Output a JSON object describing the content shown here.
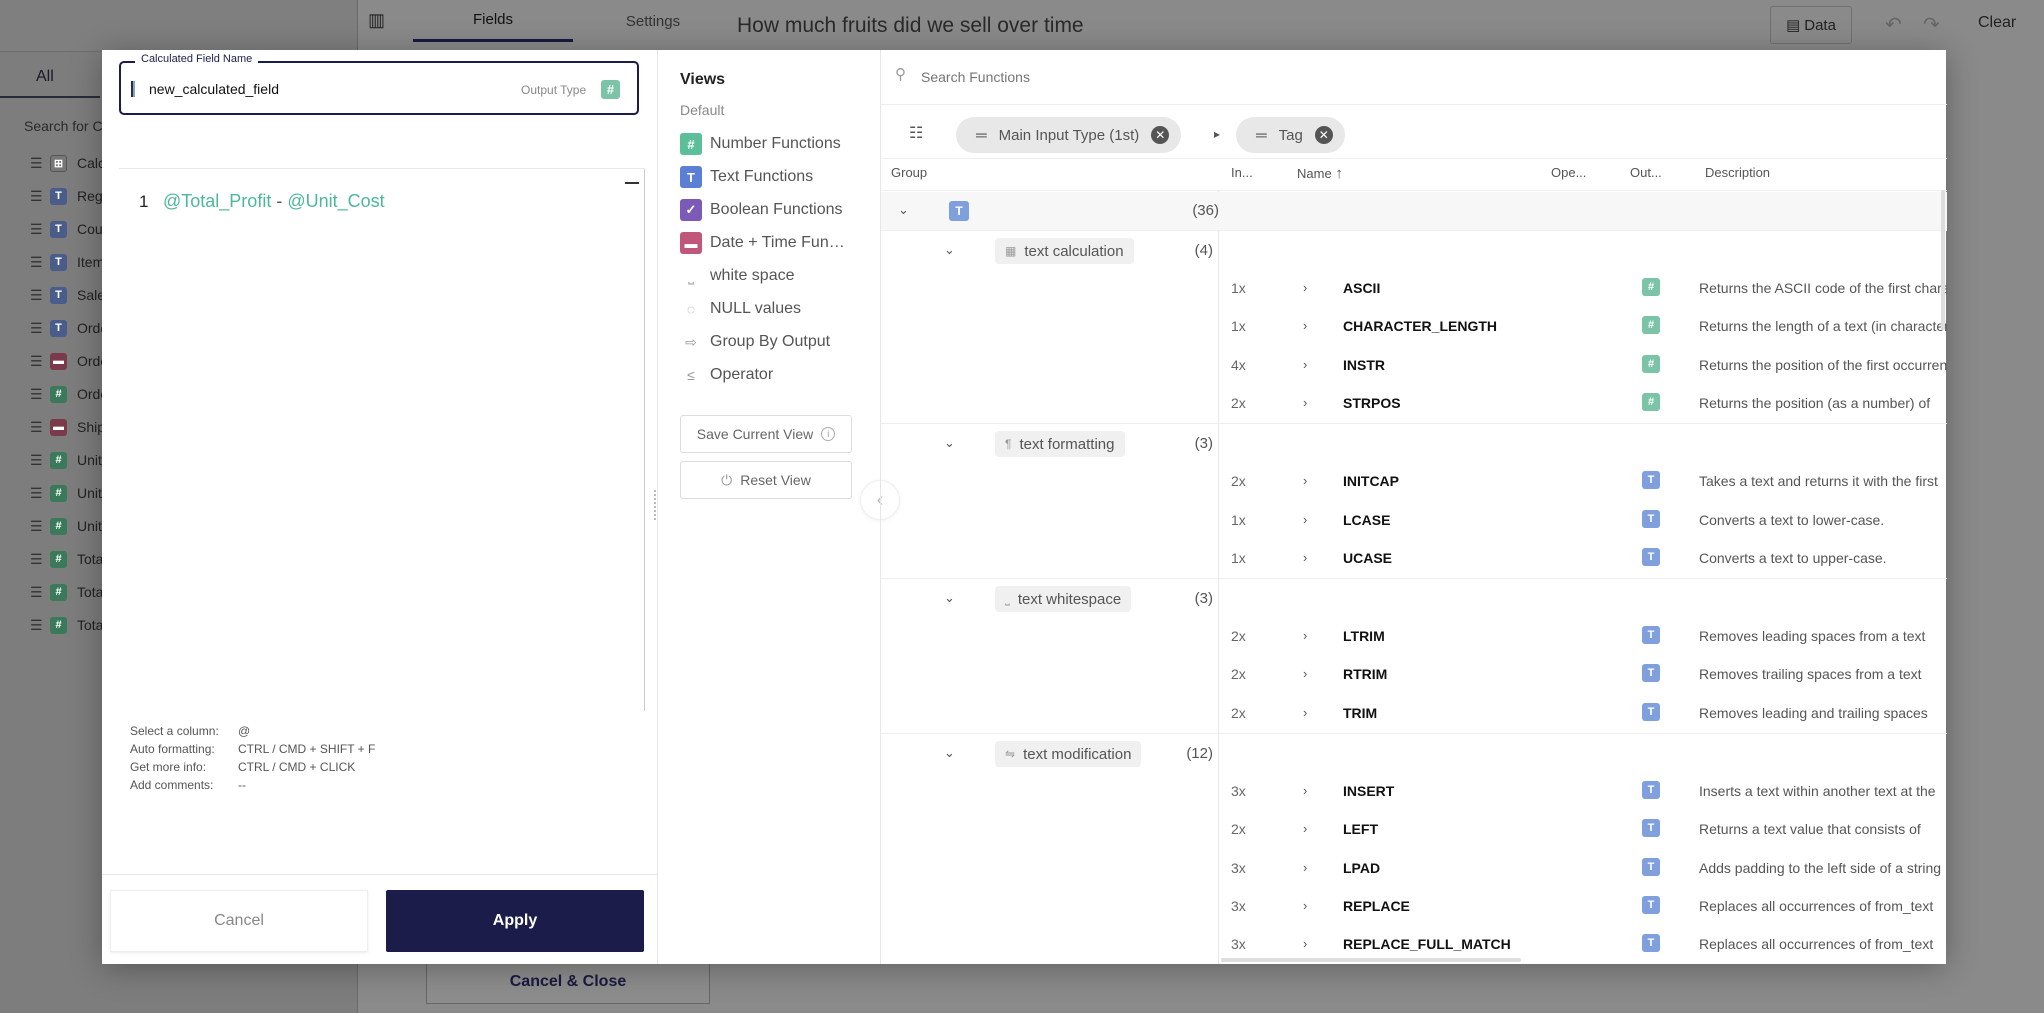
{
  "background": {
    "tab_all": "All",
    "search_placeholder": "Search for Co",
    "fields": [
      {
        "label": "Calc",
        "type": "c",
        "icon": "⊞"
      },
      {
        "label": "Regi",
        "type": "t",
        "icon": "T"
      },
      {
        "label": "Cou",
        "type": "t",
        "icon": "T"
      },
      {
        "label": "Item",
        "type": "t",
        "icon": "T"
      },
      {
        "label": "Sale",
        "type": "t",
        "icon": "T"
      },
      {
        "label": "Orde",
        "type": "t",
        "icon": "T"
      },
      {
        "label": "Orde",
        "type": "d",
        "icon": "▬"
      },
      {
        "label": "Orde",
        "type": "n",
        "icon": "#"
      },
      {
        "label": "Ship",
        "type": "d",
        "icon": "▬"
      },
      {
        "label": "Units",
        "type": "n",
        "icon": "#"
      },
      {
        "label": "Unit_",
        "type": "n",
        "icon": "#"
      },
      {
        "label": "Unit_",
        "type": "n",
        "icon": "#"
      },
      {
        "label": "Tota",
        "type": "n",
        "icon": "#"
      },
      {
        "label": "Tota",
        "type": "n",
        "icon": "#"
      },
      {
        "label": "Tota",
        "type": "n",
        "icon": "#"
      }
    ],
    "tab_fields": "Fields",
    "tab_settings": "Settings",
    "cancel_close": "Cancel & Close",
    "page_title": "How much fruits did we sell over time",
    "data_button": "Data",
    "clear_button": "Clear"
  },
  "editor": {
    "name_legend": "Calculated Field Name",
    "name_value": "new_calculated_field",
    "output_type_label": "Output Type",
    "output_type_icon": "#",
    "line_number": "1",
    "code": {
      "col1": "@Total_Profit",
      "op": " - ",
      "col2": "@Unit_Cost"
    },
    "hints": [
      {
        "key": "Select a column:",
        "value": "@"
      },
      {
        "key": "Auto formatting:",
        "value": "CTRL / CMD + SHIFT + F"
      },
      {
        "key": "Get more info:",
        "value": "CTRL / CMD + CLICK"
      },
      {
        "key": "Add comments:",
        "value": "--"
      }
    ],
    "cancel_label": "Cancel",
    "apply_label": "Apply"
  },
  "views": {
    "title": "Views",
    "default_label": "Default",
    "items": [
      {
        "label": "Number Functions",
        "icon": "#",
        "kind": "num"
      },
      {
        "label": "Text Functions",
        "icon": "T",
        "kind": "txt"
      },
      {
        "label": "Boolean Functions",
        "icon": "✓",
        "kind": "bool"
      },
      {
        "label": "Date + Time Fun…",
        "icon": "▬",
        "kind": "date"
      },
      {
        "label": "white space",
        "icon": "⎵",
        "kind": "plain"
      },
      {
        "label": "NULL values",
        "icon": "◌",
        "kind": "plain"
      },
      {
        "label": "Group By Output",
        "icon": "⇨",
        "kind": "plain"
      },
      {
        "label": "Operator",
        "icon": "≤",
        "kind": "plain"
      }
    ],
    "save_view": "Save Current View",
    "reset_view": "Reset View"
  },
  "functions": {
    "search_placeholder": "Search Functions",
    "group_chips": [
      {
        "label": "Main Input Type (1st)"
      },
      {
        "label": "Tag"
      }
    ],
    "columns": {
      "group": "Group",
      "input": "In...",
      "name": "Name",
      "operator": "Ope...",
      "output": "Out...",
      "description": "Description"
    },
    "top_group": {
      "icon": "T",
      "count": "(36)"
    },
    "groups": [
      {
        "name": "text calculation",
        "icon": "▦",
        "count": "(4)",
        "rows": [
          {
            "in": "1x",
            "name": "ASCII",
            "out": "n",
            "desc": "Returns the ASCII code of the first character"
          },
          {
            "in": "1x",
            "name": "CHARACTER_LENGTH",
            "out": "n",
            "desc": "Returns the length of a text (in characters)"
          },
          {
            "in": "4x",
            "name": "INSTR",
            "out": "n",
            "desc": "Returns the position of the first occurrence"
          },
          {
            "in": "2x",
            "name": "STRPOS",
            "out": "n",
            "desc": "Returns the position (as a number) of"
          }
        ]
      },
      {
        "name": "text formatting",
        "icon": "¶",
        "count": "(3)",
        "rows": [
          {
            "in": "2x",
            "name": "INITCAP",
            "out": "t",
            "desc": "Takes a text and returns it with the first"
          },
          {
            "in": "1x",
            "name": "LCASE",
            "out": "t",
            "desc": "Converts a text to lower-case."
          },
          {
            "in": "1x",
            "name": "UCASE",
            "out": "t",
            "desc": "Converts a text to upper-case."
          }
        ]
      },
      {
        "name": "text whitespace",
        "icon": "⎵",
        "count": "(3)",
        "rows": [
          {
            "in": "2x",
            "name": "LTRIM",
            "out": "t",
            "desc": "Removes leading spaces from a text"
          },
          {
            "in": "2x",
            "name": "RTRIM",
            "out": "t",
            "desc": "Removes trailing spaces from a text"
          },
          {
            "in": "2x",
            "name": "TRIM",
            "out": "t",
            "desc": "Removes leading and trailing spaces"
          }
        ]
      },
      {
        "name": "text modification",
        "icon": "⇋",
        "count": "(12)",
        "rows": [
          {
            "in": "3x",
            "name": "INSERT",
            "out": "t",
            "desc": "Inserts a text within another text at the"
          },
          {
            "in": "2x",
            "name": "LEFT",
            "out": "t",
            "desc": "Returns a text value that consists of"
          },
          {
            "in": "3x",
            "name": "LPAD",
            "out": "t",
            "desc": "Adds padding to the left side of a string"
          },
          {
            "in": "3x",
            "name": "REPLACE",
            "out": "t",
            "desc": "Replaces all occurrences of from_text"
          },
          {
            "in": "3x",
            "name": "REPLACE_FULL_MATCH",
            "out": "t",
            "desc": "Replaces all occurrences of from_text"
          }
        ]
      }
    ]
  }
}
